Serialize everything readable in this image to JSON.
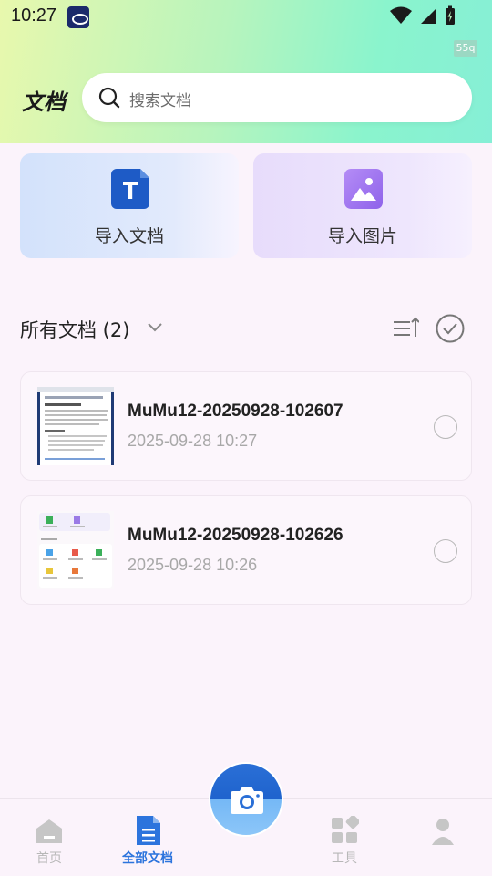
{
  "status_bar": {
    "time": "10:27",
    "fps_badge": "55q"
  },
  "header": {
    "title": "文档",
    "search_placeholder": "搜索文档"
  },
  "import_actions": [
    {
      "label": "导入文档",
      "icon": "word-doc-icon"
    },
    {
      "label": "导入图片",
      "icon": "image-icon"
    }
  ],
  "section": {
    "title": "所有文档 (2)"
  },
  "documents": [
    {
      "name": "MuMu12-20250928-102607",
      "date": "2025-09-28 10:27"
    },
    {
      "name": "MuMu12-20250928-102626",
      "date": "2025-09-28 10:26"
    }
  ],
  "bottom_nav": [
    {
      "label": "首页",
      "icon": "home-icon",
      "active": false
    },
    {
      "label": "全部文档",
      "icon": "document-icon",
      "active": true
    },
    {
      "label": "",
      "icon": "camera-icon",
      "active": false
    },
    {
      "label": "工具",
      "icon": "tools-icon",
      "active": false
    },
    {
      "label": "",
      "icon": "profile-icon",
      "active": false
    }
  ],
  "colors": {
    "accent": "#2c74dd",
    "header_gradient_start": "#e8f8ad",
    "header_gradient_end": "#86efd6",
    "page_background": "#fbf3fb",
    "inactive_nav": "#b7b7b7"
  }
}
